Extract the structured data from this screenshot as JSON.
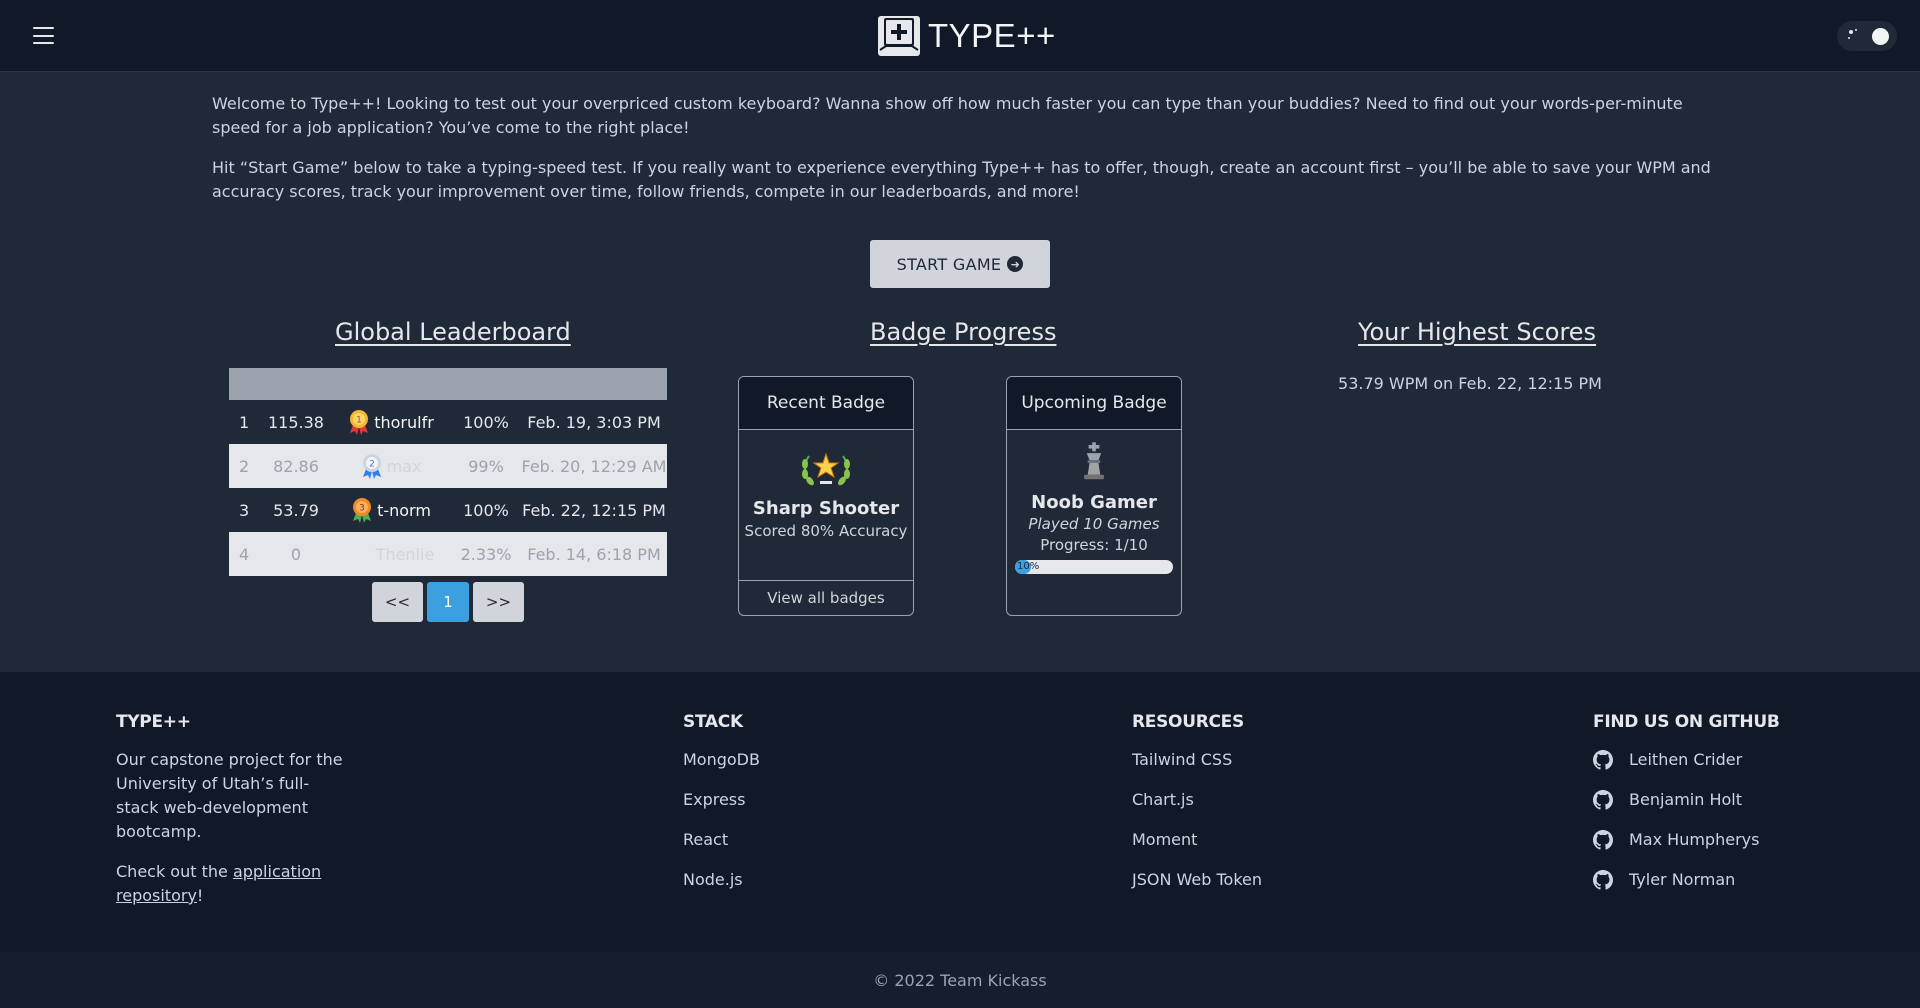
{
  "header": {
    "logo_text": "TYPE++",
    "menu_icon": "hamburger-menu-icon",
    "theme_toggle_icon": "sun-icon"
  },
  "intro": {
    "paragraph1": "Welcome to Type++! Looking to test out your overpriced custom keyboard? Wanna show off how much faster you can type than your buddies? Need to find out your words-per-minute speed for a job application? You’ve come to the right place!",
    "paragraph2": "Hit “Start Game” below to take a typing-speed test. If you really want to experience everything Type++ has to offer, though, create an account first – you’ll be able to save your WPM and accuracy scores, track your improvement over time, follow friends, compete in our leaderboards, and more!"
  },
  "start_button": {
    "label": "START GAME",
    "icon": "arrow-right-circle-icon"
  },
  "leaderboard": {
    "title": "Global Leaderboard",
    "rows": [
      {
        "rank": "1",
        "wpm": "115.38",
        "medal": "1",
        "user": "thorulfr",
        "accuracy": "100%",
        "date": "Feb. 19, 3:03 PM"
      },
      {
        "rank": "2",
        "wpm": "82.86",
        "medal": "2",
        "user": "max",
        "accuracy": "99%",
        "date": "Feb. 20, 12:29 AM"
      },
      {
        "rank": "3",
        "wpm": "53.79",
        "medal": "3",
        "user": "t-norm",
        "accuracy": "100%",
        "date": "Feb. 22, 12:15 PM"
      },
      {
        "rank": "4",
        "wpm": "0",
        "medal": "",
        "user": "Thenlie",
        "accuracy": "2.33%",
        "date": "Feb. 14, 6:18 PM"
      }
    ],
    "pagination": {
      "prev": "<<",
      "current": "1",
      "next": ">>"
    }
  },
  "badges": {
    "title": "Badge Progress",
    "recent": {
      "header": "Recent Badge",
      "icon": "star-laurel-icon",
      "name": "Sharp Shooter",
      "description": "Scored 80% Accuracy",
      "footer": "View all badges"
    },
    "upcoming": {
      "header": "Upcoming Badge",
      "icon": "chess-king-icon",
      "name": "Noob Gamer",
      "description": "Played 10 Games",
      "progress_text": "Progress: 1/10",
      "progress_label": "10%",
      "progress_value": 0.1
    }
  },
  "high_scores": {
    "title": "Your Highest Scores",
    "entries": [
      "53.79 WPM on Feb. 22, 12:15 PM"
    ]
  },
  "footer": {
    "about": {
      "heading": "TYPE++",
      "text": "Our capstone project for the University of Utah’s full-stack web-development bootcamp.",
      "repo_prefix": "Check out the ",
      "repo_link": "application repository",
      "repo_suffix": "!"
    },
    "stack": {
      "heading": "STACK",
      "items": [
        "MongoDB",
        "Express",
        "React",
        "Node.js"
      ]
    },
    "resources": {
      "heading": "RESOURCES",
      "items": [
        "Tailwind CSS",
        "Chart.js",
        "Moment",
        "JSON Web Token"
      ]
    },
    "github": {
      "heading": "FIND US ON GITHUB",
      "icon": "github-icon",
      "items": [
        "Leithen Crider",
        "Benjamin Holt",
        "Max Humpherys",
        "Tyler Norman"
      ]
    },
    "copyright": "© 2022 Team Kickass"
  },
  "colors": {
    "background": "#1f2937",
    "navbar": "#111827",
    "accent": "#3b9fe0",
    "button": "#d1d5db"
  }
}
